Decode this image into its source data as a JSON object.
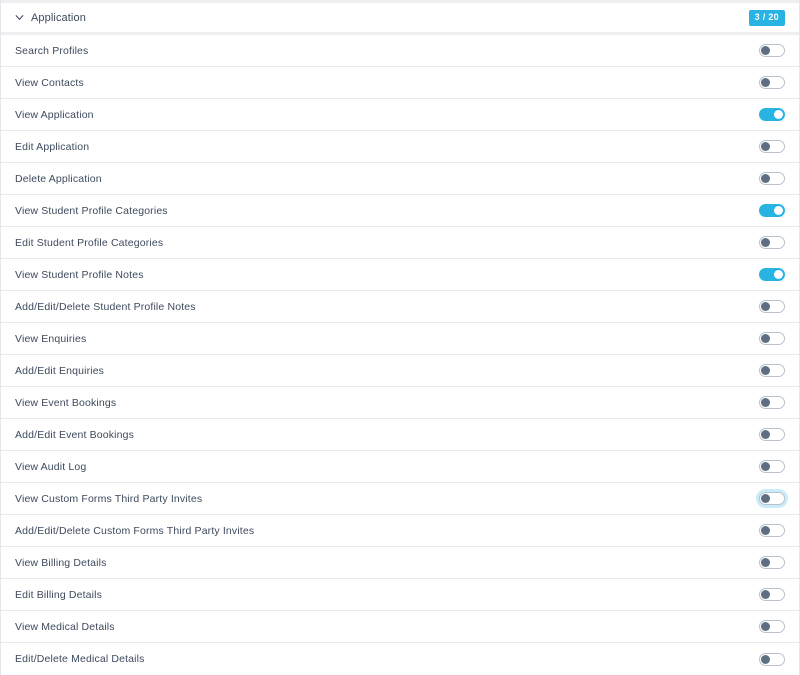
{
  "group": {
    "title": "Application",
    "collapse_icon": "chevron-down-icon",
    "expanded": true,
    "badge": "3 / 20",
    "enabled_count": 3,
    "total_count": 20
  },
  "colors": {
    "accent": "#29b3e3",
    "badge_bg": "#29b3e3",
    "badge_text": "#ffffff",
    "text": "#3d4a5c",
    "row_border": "#e7e9ec",
    "header_border": "#eceef0",
    "toggle_off_knob": "#5d6f80",
    "toggle_off_border": "#b9c2cc",
    "panel_bg": "#ffffff"
  },
  "permissions": [
    {
      "label": "Search Profiles",
      "enabled": false,
      "focused": false
    },
    {
      "label": "View Contacts",
      "enabled": false,
      "focused": false
    },
    {
      "label": "View Application",
      "enabled": true,
      "focused": false
    },
    {
      "label": "Edit Application",
      "enabled": false,
      "focused": false
    },
    {
      "label": "Delete Application",
      "enabled": false,
      "focused": false
    },
    {
      "label": "View Student Profile Categories",
      "enabled": true,
      "focused": false
    },
    {
      "label": "Edit Student Profile Categories",
      "enabled": false,
      "focused": false
    },
    {
      "label": "View Student Profile Notes",
      "enabled": true,
      "focused": false
    },
    {
      "label": "Add/Edit/Delete Student Profile Notes",
      "enabled": false,
      "focused": false
    },
    {
      "label": "View Enquiries",
      "enabled": false,
      "focused": false
    },
    {
      "label": "Add/Edit Enquiries",
      "enabled": false,
      "focused": false
    },
    {
      "label": "View Event Bookings",
      "enabled": false,
      "focused": false
    },
    {
      "label": "Add/Edit Event Bookings",
      "enabled": false,
      "focused": false
    },
    {
      "label": "View Audit Log",
      "enabled": false,
      "focused": false
    },
    {
      "label": "View Custom Forms Third Party Invites",
      "enabled": false,
      "focused": true
    },
    {
      "label": "Add/Edit/Delete Custom Forms Third Party Invites",
      "enabled": false,
      "focused": false
    },
    {
      "label": "View Billing Details",
      "enabled": false,
      "focused": false
    },
    {
      "label": "Edit Billing Details",
      "enabled": false,
      "focused": false
    },
    {
      "label": "View Medical Details",
      "enabled": false,
      "focused": false
    },
    {
      "label": "Edit/Delete Medical Details",
      "enabled": false,
      "focused": false
    }
  ]
}
